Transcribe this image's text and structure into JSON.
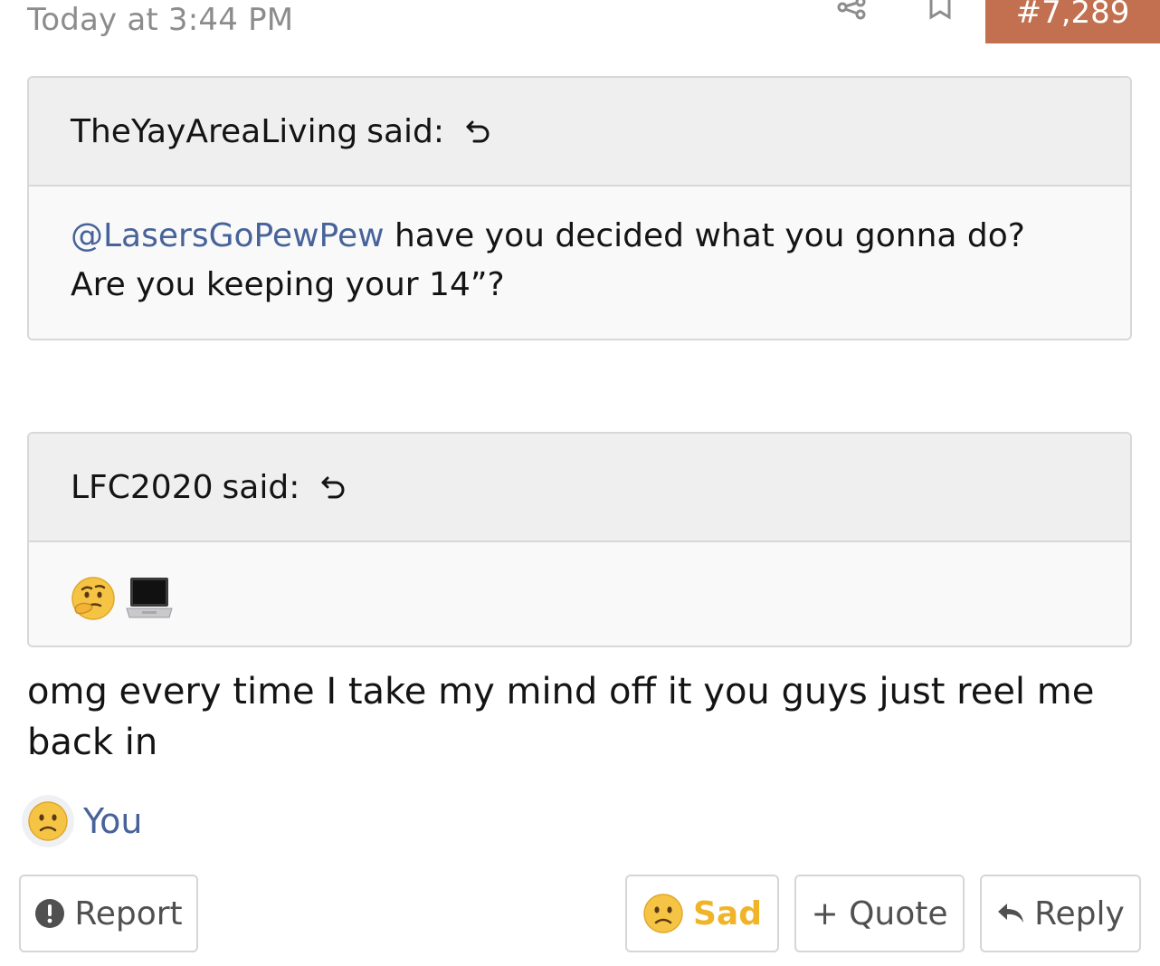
{
  "post": {
    "timestamp": "Today at 3:44 PM",
    "number": "#7,289",
    "icons": {
      "share": "share-icon",
      "bookmark": "bookmark-icon"
    }
  },
  "quotes": [
    {
      "author": "TheYayAreaLiving",
      "said": "said:",
      "mention": "@LasersGoPewPew",
      "text": " have you decided what you gonna do? Are you keeping your 14”?"
    },
    {
      "author": "LFC2020",
      "said": "said:",
      "emoji": [
        "thinking-face",
        "laptop"
      ]
    }
  ],
  "message": "omg every time I take my mind off it you guys just reel me back in",
  "reactions": {
    "emoji": "sad-face",
    "user": "You"
  },
  "actions": {
    "report": "Report",
    "sad": "Sad",
    "quote": "+ Quote",
    "reply": "Reply"
  },
  "colors": {
    "accent": "#c2704f",
    "link": "#47639a",
    "sad": "#f0b429"
  }
}
